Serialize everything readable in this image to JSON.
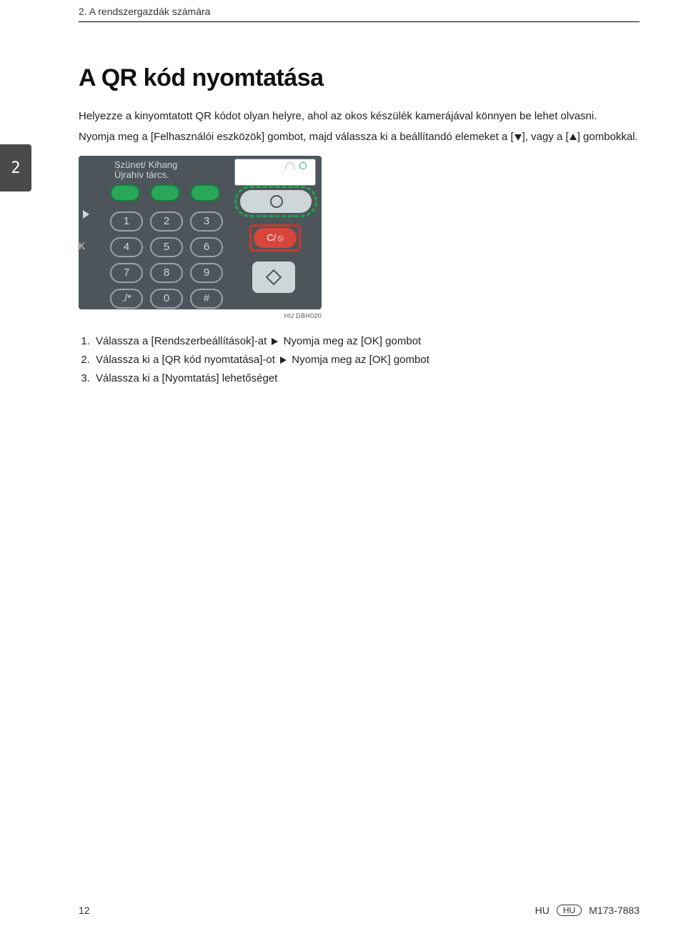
{
  "header": {
    "chapter_title": "2. A rendszergazdák számára"
  },
  "chapter_tab": "2",
  "title": "A QR kód nyomtatása",
  "intro": "Helyezze a kinyomtatott QR kódot olyan helyre, ahol az okos készülék kamerájával könnyen be lehet olvasni.",
  "para2": {
    "p1": "Nyomja meg a [Felhasználói eszközök] gombot, majd válassza ki a beállítandó elemeket a [",
    "p2": "], vagy a [",
    "p3": "] gombokkal."
  },
  "device": {
    "top_labels": {
      "line1": "Szünet/  Kihang",
      "line2": "Újrahív  tárcs."
    },
    "keys": [
      "1",
      "2",
      "3",
      "4",
      "5",
      "6",
      "7",
      "8",
      "9",
      "./*",
      "0",
      "#"
    ],
    "ok_edge": "K",
    "clear_label": "C/",
    "caption": "HU DBH020"
  },
  "steps": [
    {
      "a": "Válassza a [Rendszerbeállítások]-at",
      "b": "Nyomja meg az [OK] gombot"
    },
    {
      "a": "Válassza ki a [QR kód nyomtatása]-ot",
      "b": "Nyomja meg az [OK] gombot"
    },
    {
      "a": "Válassza ki a [Nyomtatás] lehetőséget",
      "b": ""
    }
  ],
  "footer": {
    "page": "12",
    "lang_short": "HU",
    "lang_pill": "HU",
    "doc_code": "M173-7883"
  }
}
